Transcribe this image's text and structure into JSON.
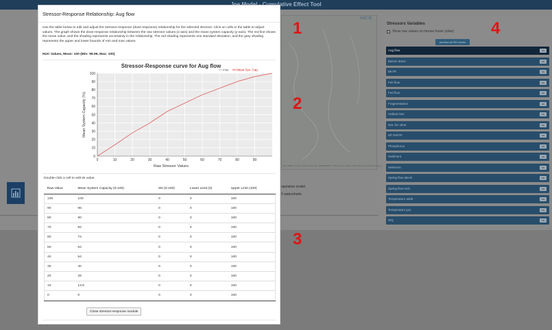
{
  "app": {
    "title": "Joe Model - Cumulative Effect Tool",
    "huc_id_label": "HUC ID",
    "map_attribution": "Esri, HERE, Garmin, USGS, Intermap, INCREMENT P, NRCan, Esri Japan, METI, Esri China (Hong Kong), and the GIS User Community",
    "background_text_1": "opulation model",
    "background_text_2": "0 watersheds",
    "icon_name": "bar-chart-icon"
  },
  "modal": {
    "title": "Stressor-Response Relationship: Aug flow",
    "description": "Use the table below to edit and adjust the stressor-response (dose-response) relationship for the selected stressor. Click on cells in the table to adjust values. The graph shows the dose-response relationship between the raw stressor values (x-axis) and the mean system capacity (y-axis). The red line shows the mean value, and the shading represents uncertainty in the relationship. The red shading represents one standard deviation, and the grey shading represents the upper and lower bounds of min and max values.",
    "huc_values": "HUC Values, Mean: 100 (Min: 99.96, Max: 100)",
    "double_click_hint": "Double-click a cell to edit its value.",
    "close_button": "Close stressor-response module",
    "table": {
      "headers": [
        "Raw Value",
        "Mean System Capacity (0-100)",
        "SD (0-100)",
        "Lower Limit (0)",
        "Upper Limit (100)"
      ],
      "rows": [
        [
          "100",
          "100",
          "0",
          "0",
          "100"
        ],
        [
          "90",
          "96",
          "0",
          "0",
          "100"
        ],
        [
          "80",
          "90",
          "0",
          "0",
          "100"
        ],
        [
          "70",
          "82",
          "0",
          "0",
          "100"
        ],
        [
          "60",
          "74",
          "0",
          "0",
          "100"
        ],
        [
          "50",
          "64",
          "0",
          "0",
          "100"
        ],
        [
          "40",
          "54",
          "0",
          "0",
          "100"
        ],
        [
          "30",
          "40",
          "0",
          "0",
          "100"
        ],
        [
          "20",
          "28",
          "0",
          "0",
          "100"
        ],
        [
          "10",
          "13.6",
          "0",
          "0",
          "100"
        ],
        [
          "0",
          "0",
          "0",
          "0",
          "100"
        ]
      ]
    }
  },
  "chart_data": {
    "type": "line",
    "title": "Stressor-Response curve for Aug flow",
    "xlabel": "Raw Stressor Values",
    "ylabel": "Mean System Capacity (%)",
    "xlim": [
      0,
      100
    ],
    "ylim": [
      0,
      100
    ],
    "xticks": [
      0,
      10,
      20,
      30,
      40,
      50,
      60,
      70,
      80,
      90
    ],
    "yticks": [
      0,
      10,
      20,
      30,
      40,
      50,
      60,
      70,
      80,
      90,
      100
    ],
    "grid": true,
    "legend_position": "top-right",
    "legend": [
      {
        "label": "mse",
        "color": "#aaaaaa"
      },
      {
        "label": "Mean Sys. Cap.",
        "color": "#e31a1c"
      }
    ],
    "series": [
      {
        "name": "Mean Sys. Cap.",
        "color": "#e07070",
        "x": [
          0,
          10,
          20,
          30,
          40,
          50,
          60,
          70,
          80,
          90,
          100
        ],
        "y": [
          0,
          13.6,
          28,
          40,
          54,
          64,
          74,
          82,
          90,
          96,
          100
        ]
      }
    ]
  },
  "sidebar": {
    "title": "Stressors Variables",
    "checkbox_label": "Show raw values on mouse hover (slow)",
    "preview_button": "preview all SR curves",
    "se_label": "S/E",
    "items": [
      {
        "label": "Aug flow",
        "active": true
      },
      {
        "label": "Barrier dams",
        "active": false
      },
      {
        "label": "BKTR",
        "active": false
      },
      {
        "label": "Feb flow",
        "active": false
      },
      {
        "label": "Fed flow",
        "active": false
      },
      {
        "label": "Fragmentation",
        "active": false
      },
      {
        "label": "Habitat loss",
        "active": false
      },
      {
        "label": "Nat. lim other",
        "active": false
      },
      {
        "label": "Nfr RWTR",
        "active": false
      },
      {
        "label": "Phosphorus",
        "active": false
      },
      {
        "label": "Sediment",
        "active": false
      },
      {
        "label": "Selenium",
        "active": false
      },
      {
        "label": "Spring flow alevin",
        "active": false
      },
      {
        "label": "Spring flow incb",
        "active": false
      },
      {
        "label": "Temperature adult",
        "active": false
      },
      {
        "label": "Temperature juvi",
        "active": false
      },
      {
        "label": "WQ",
        "active": false
      }
    ]
  },
  "annotations": [
    "1",
    "2",
    "3",
    "4"
  ],
  "colors": {
    "accent": "#e01414",
    "sidebar_item": "#284d6a",
    "line": "#e07070"
  }
}
